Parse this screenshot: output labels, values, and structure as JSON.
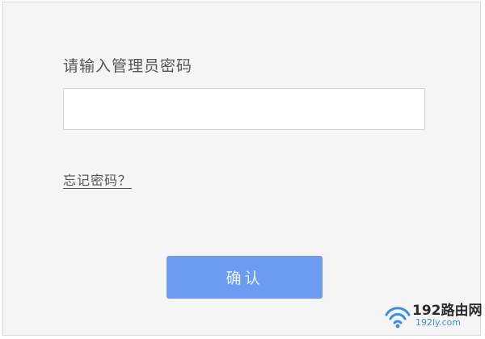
{
  "login": {
    "prompt": "请输入管理员密码",
    "password_value": "",
    "forgot_label": "忘记密码？",
    "confirm_label": "确认"
  },
  "watermark": {
    "title": "192路由网",
    "url": "192ly.com",
    "icon": "wifi-icon"
  },
  "colors": {
    "primary_button": "#6b9cf2",
    "panel_background": "#f5f5f5",
    "watermark_url": "#3a8ee6"
  }
}
